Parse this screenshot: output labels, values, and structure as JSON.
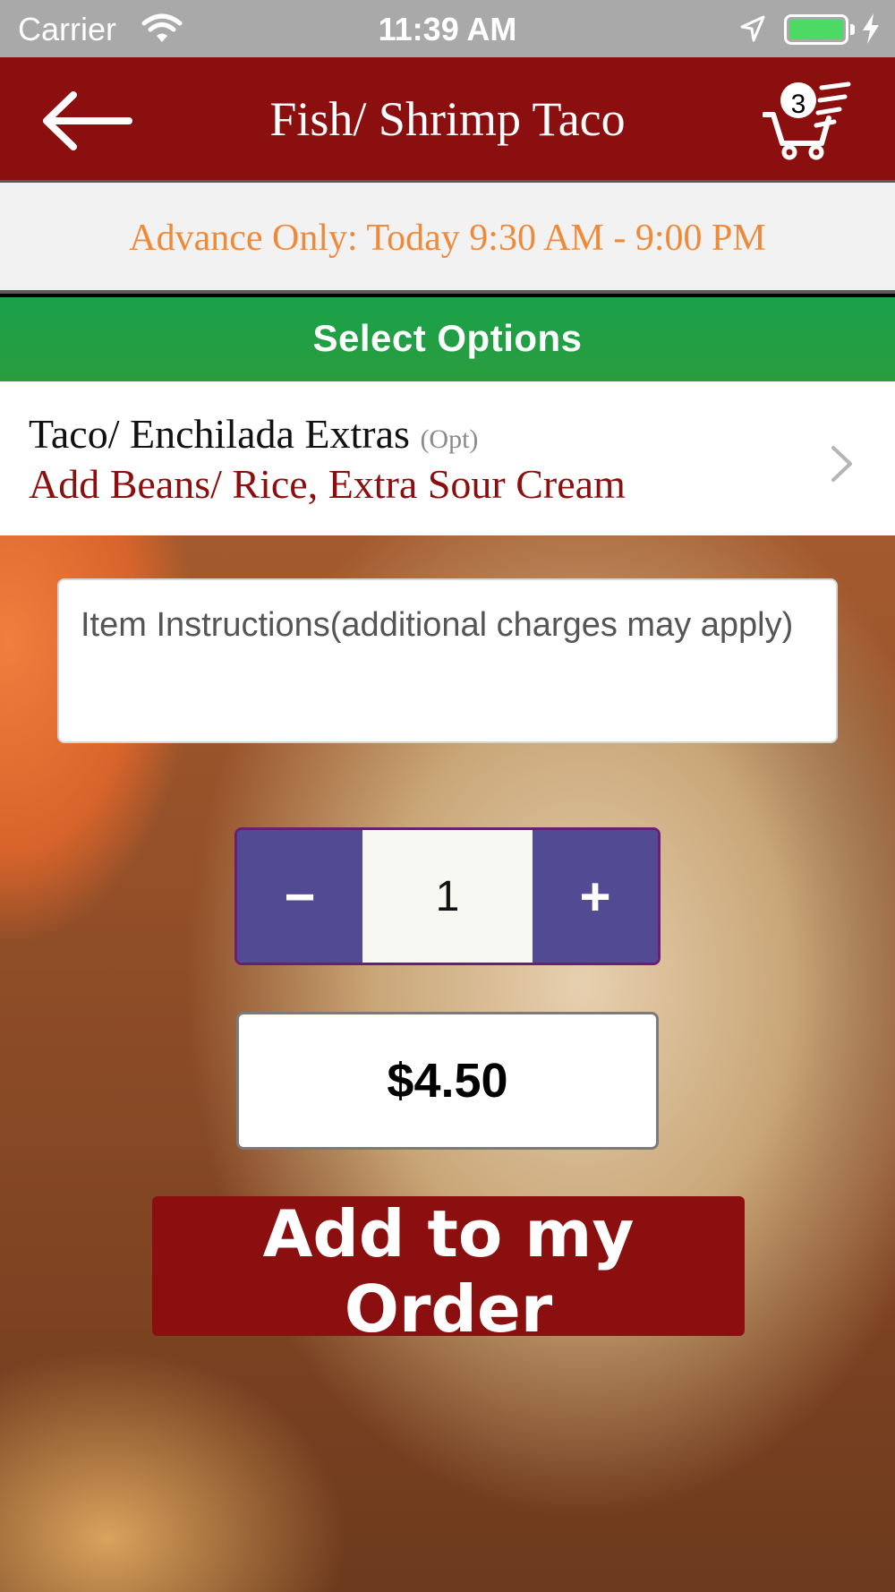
{
  "status_bar": {
    "carrier": "Carrier",
    "time": "11:39 AM",
    "battery_level": 1.0,
    "battery_color": "#4cd964"
  },
  "nav_bar": {
    "back_icon": "arrow-left-icon",
    "title": "Fish/ Shrimp Taco",
    "cart_icon": "shopping-cart-icon",
    "cart_count": "3",
    "color": "#8c0f10"
  },
  "hours": {
    "text": "Advance Only: Today 9:30 AM - 9:00 PM"
  },
  "options": {
    "header": "Select Options",
    "items": [
      {
        "name": "Taco/ Enchilada Extras",
        "tag": "(Opt)",
        "value": "Add Beans/ Rice, Extra Sour Cream"
      }
    ]
  },
  "instructions": {
    "placeholder": "Item Instructions(additional charges may apply)"
  },
  "quantity": {
    "minus_label": "−",
    "value": "1",
    "plus_label": "+"
  },
  "price": "$4.50",
  "add_button": "Add to my Order"
}
